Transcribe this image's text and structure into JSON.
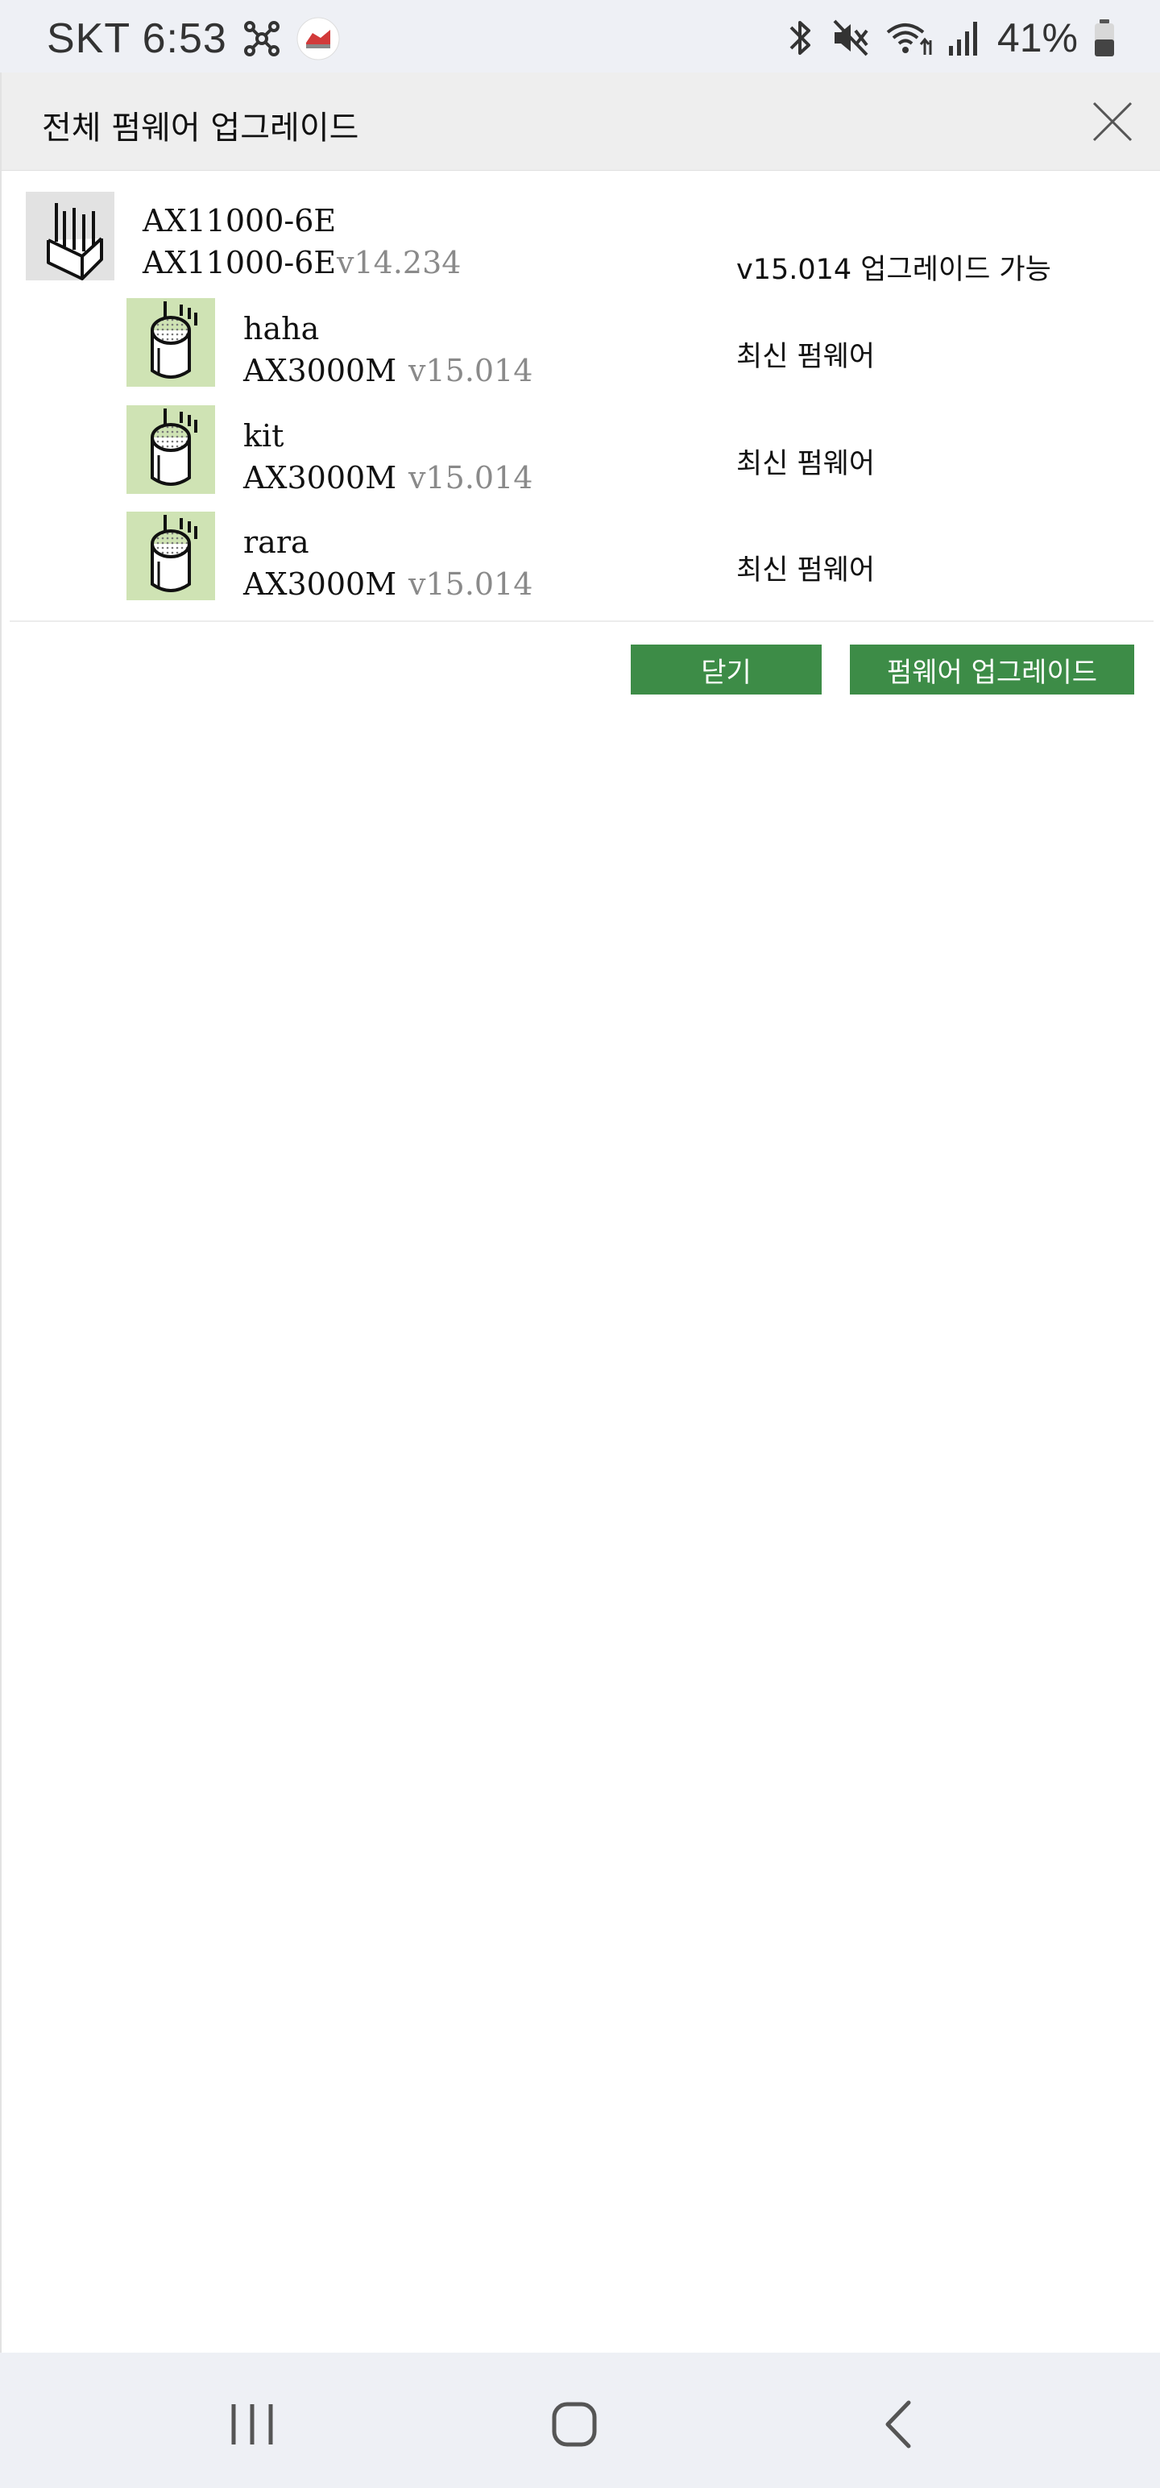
{
  "status_bar": {
    "carrier_time": "SKT 6:53",
    "battery_percent": "41%",
    "icons": [
      "network-hub-icon",
      "app-notification-icon",
      "bluetooth-icon",
      "mute-icon",
      "wifi-icon",
      "signal-icon",
      "battery-icon"
    ]
  },
  "dialog": {
    "title": "전체 펌웨어 업그레이드",
    "devices": [
      {
        "name": "AX11000-6E",
        "model": "AX11000-6E",
        "version": "v14.234",
        "status": "v15.014 업그레이드 가능",
        "icon": "router-icon"
      },
      {
        "name": "haha",
        "model": "AX3000M",
        "version": "v15.014",
        "status": "최신 펌웨어",
        "icon": "mesh-node-icon"
      },
      {
        "name": "kit",
        "model": "AX3000M",
        "version": "v15.014",
        "status": "최신 펌웨어",
        "icon": "mesh-node-icon"
      },
      {
        "name": "rara",
        "model": "AX3000M",
        "version": "v15.014",
        "status": "최신 펌웨어",
        "icon": "mesh-node-icon"
      }
    ],
    "buttons": {
      "close_label": "닫기",
      "upgrade_label": "펌웨어 업그레이드"
    }
  },
  "colors": {
    "button_green": "#3d8c47",
    "node_icon_bg": "#cfe3b4",
    "main_icon_bg": "#e2e2e2"
  },
  "nav_bar": {
    "icons": [
      "recents-icon",
      "home-icon",
      "back-icon"
    ]
  }
}
